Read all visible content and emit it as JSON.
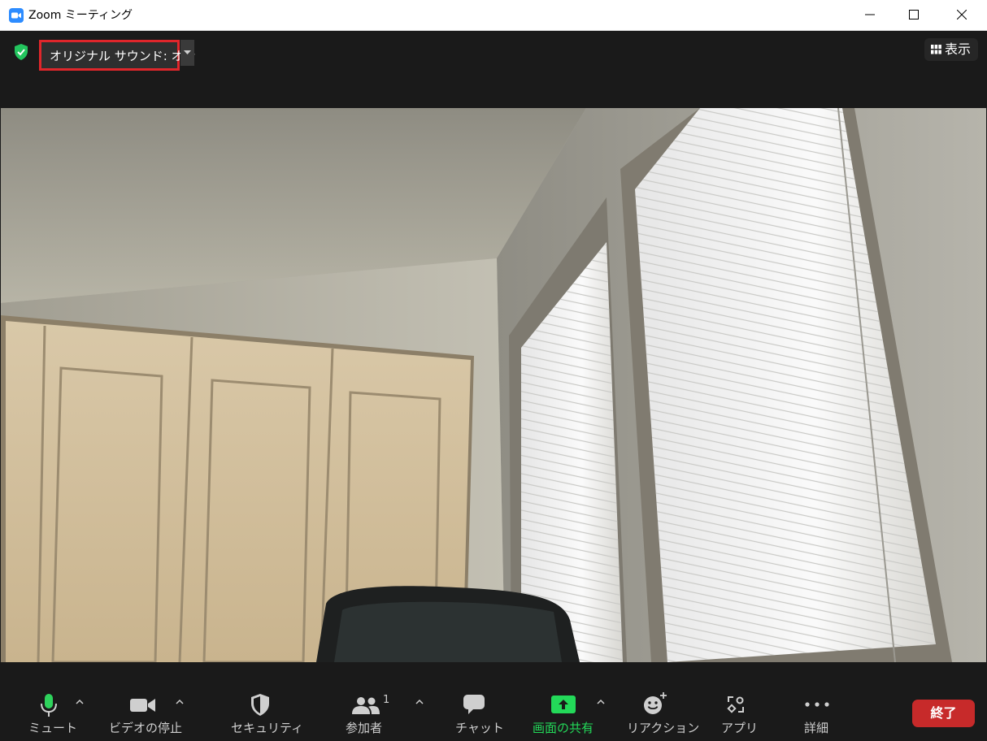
{
  "window": {
    "title": "Zoom ミーティング"
  },
  "topbar": {
    "original_sound_label": "オリジナル サウンド: オン",
    "view_label": "表示"
  },
  "toolbar": {
    "mute_label": "ミュート",
    "video_label": "ビデオの停止",
    "security_label": "セキュリティ",
    "participants_label": "参加者",
    "participants_count": "1",
    "chat_label": "チャット",
    "share_label": "画面の共有",
    "reactions_label": "リアクション",
    "apps_label": "アプリ",
    "more_label": "詳細",
    "end_label": "終了"
  },
  "colors": {
    "accent_blue": "#2d8cff",
    "share_green": "#23d959",
    "end_red": "#c72a2a",
    "highlight_red": "#e0262b"
  }
}
